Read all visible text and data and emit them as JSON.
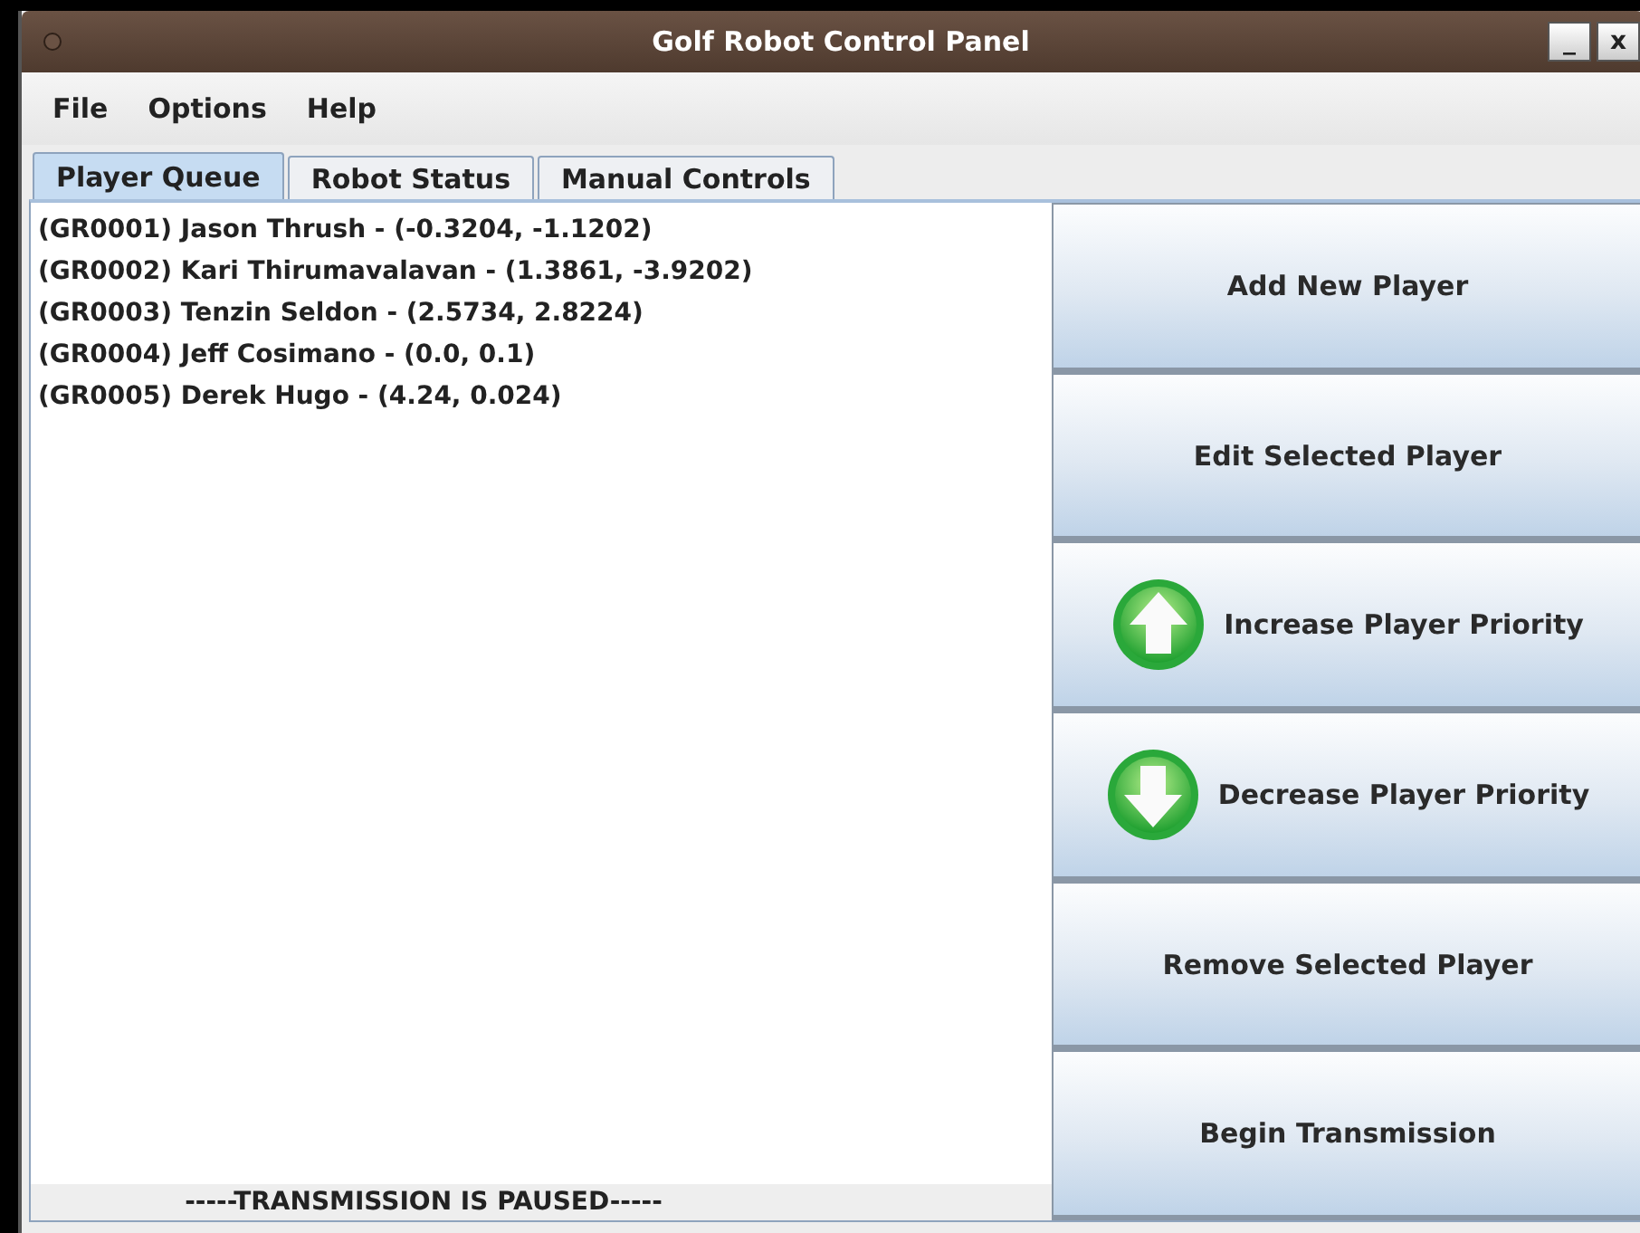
{
  "window": {
    "title": "Golf Robot Control Panel",
    "controls": [
      "_",
      "x"
    ]
  },
  "menu": [
    "File",
    "Options",
    "Help"
  ],
  "tabs": [
    {
      "label": "Player Queue",
      "selected": true
    },
    {
      "label": "Robot Status",
      "selected": false
    },
    {
      "label": "Manual Controls",
      "selected": false
    }
  ],
  "players": [
    "(GR0001) Jason Thrush - (-0.3204, -1.1202)",
    "(GR0002) Kari Thirumavalavan - (1.3861, -3.9202)",
    "(GR0003) Tenzin Seldon - (2.5734, 2.8224)",
    "(GR0004) Jeff Cosimano - (0.0, 0.1)",
    "(GR0005) Derek Hugo - (4.24, 0.024)"
  ],
  "status": "-----TRANSMISSION IS PAUSED-----",
  "buttons": [
    {
      "label": "Add New Player",
      "kind": "plain"
    },
    {
      "label": "Edit Selected Player",
      "kind": "plain"
    },
    {
      "label": "Increase Player Priority",
      "kind": "up"
    },
    {
      "label": "Decrease Player Priority",
      "kind": "down"
    },
    {
      "label": "Remove Selected Player",
      "kind": "plain"
    },
    {
      "label": "Begin Transmission",
      "kind": "plain"
    }
  ]
}
